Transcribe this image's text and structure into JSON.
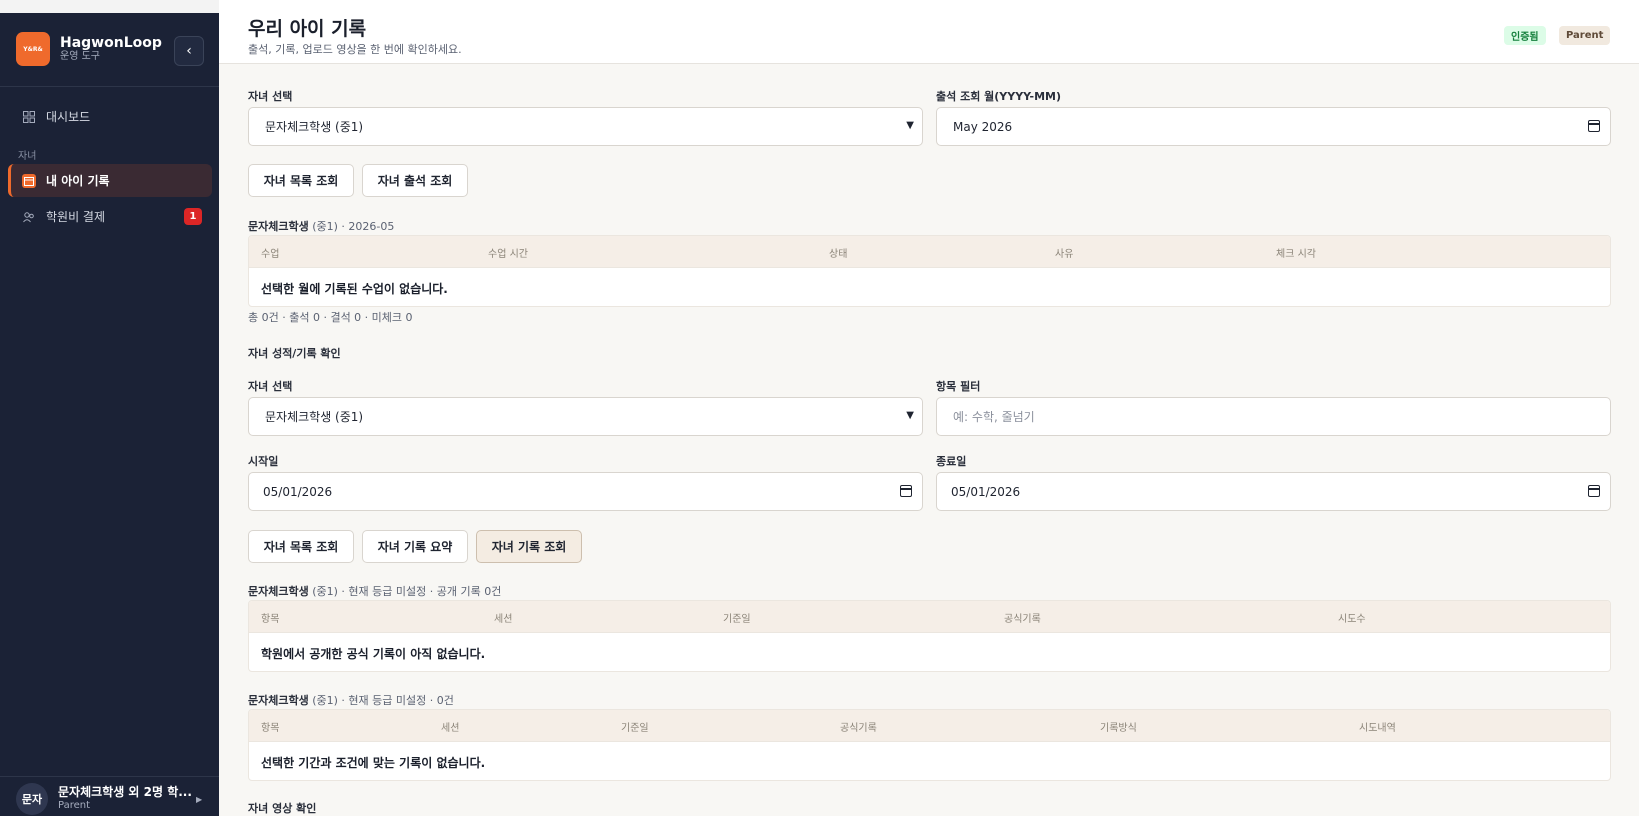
{
  "sidebar": {
    "brand_name": "HagwonLoop",
    "brand_sub": "운영 도구",
    "logo_text": "Y&R&",
    "collapse_icon": "chevron-left-icon",
    "items": [
      {
        "label": "대시보드",
        "icon": "dashboard-icon"
      },
      {
        "group": "자녀"
      },
      {
        "label": "내 아이 기록",
        "icon": "calendar-icon",
        "active": true
      },
      {
        "label": "학원비 결제",
        "icon": "payment-icon",
        "badge": "1"
      }
    ],
    "user": {
      "avatar": "문자",
      "name": "문자체크학생 외 2명 학...",
      "role": "Parent"
    }
  },
  "header": {
    "title": "우리 아이 기록",
    "subtitle": "출석, 기록, 업로드 영상을 한 번에 확인하세요.",
    "badge_verified": "인증됨",
    "badge_role": "Parent"
  },
  "attendance": {
    "child_label": "자녀 선택",
    "child_value": "문자체크학생 (중1)",
    "month_label": "출석 조회 월(YYYY-MM)",
    "month_value": "May 2026",
    "btn_list": "자녀 목록 조회",
    "btn_attendance": "자녀 출석 조회",
    "caption_name": "문자체크학생",
    "caption_rest": "(중1) · 2026-05",
    "columns": [
      "수업",
      "수업 시간",
      "상태",
      "사유",
      "체크 시각"
    ],
    "empty": "선택한 월에 기록된 수업이 없습니다.",
    "summary": "총 0건 · 출석 0 · 결석 0 · 미체크 0"
  },
  "records": {
    "section_title": "자녀 성적/기록 확인",
    "child_label": "자녀 선택",
    "child_value": "문자체크학생 (중1)",
    "filter_label": "항목 필터",
    "filter_placeholder": "예: 수학, 줄넘기",
    "start_label": "시작일",
    "start_value": "05/01/2026",
    "end_label": "종료일",
    "end_value": "05/01/2026",
    "btn_list": "자녀 목록 조회",
    "btn_summary": "자녀 기록 요약",
    "btn_records": "자녀 기록 조회",
    "official": {
      "caption_name": "문자체크학생",
      "caption_rest": "(중1) · 현재 등급 미설정 · 공개 기록 0건",
      "columns": [
        "항목",
        "세션",
        "기준일",
        "공식기록",
        "시도수"
      ],
      "empty": "학원에서 공개한 공식 기록이 아직 없습니다."
    },
    "all": {
      "caption_name": "문자체크학생",
      "caption_rest": "(중1) · 현재 등급 미설정 · 0건",
      "columns": [
        "항목",
        "세션",
        "기준일",
        "공식기록",
        "기록방식",
        "시도내역"
      ],
      "empty": "선택한 기간과 조건에 맞는 기록이 없습니다."
    }
  },
  "video": {
    "section_title": "자녀 영상 확인"
  },
  "colors": {
    "sidebar": "#1b2236",
    "accent": "#ef6a2c",
    "badge_red": "#dc2626",
    "table_head": "#f5eee7"
  }
}
